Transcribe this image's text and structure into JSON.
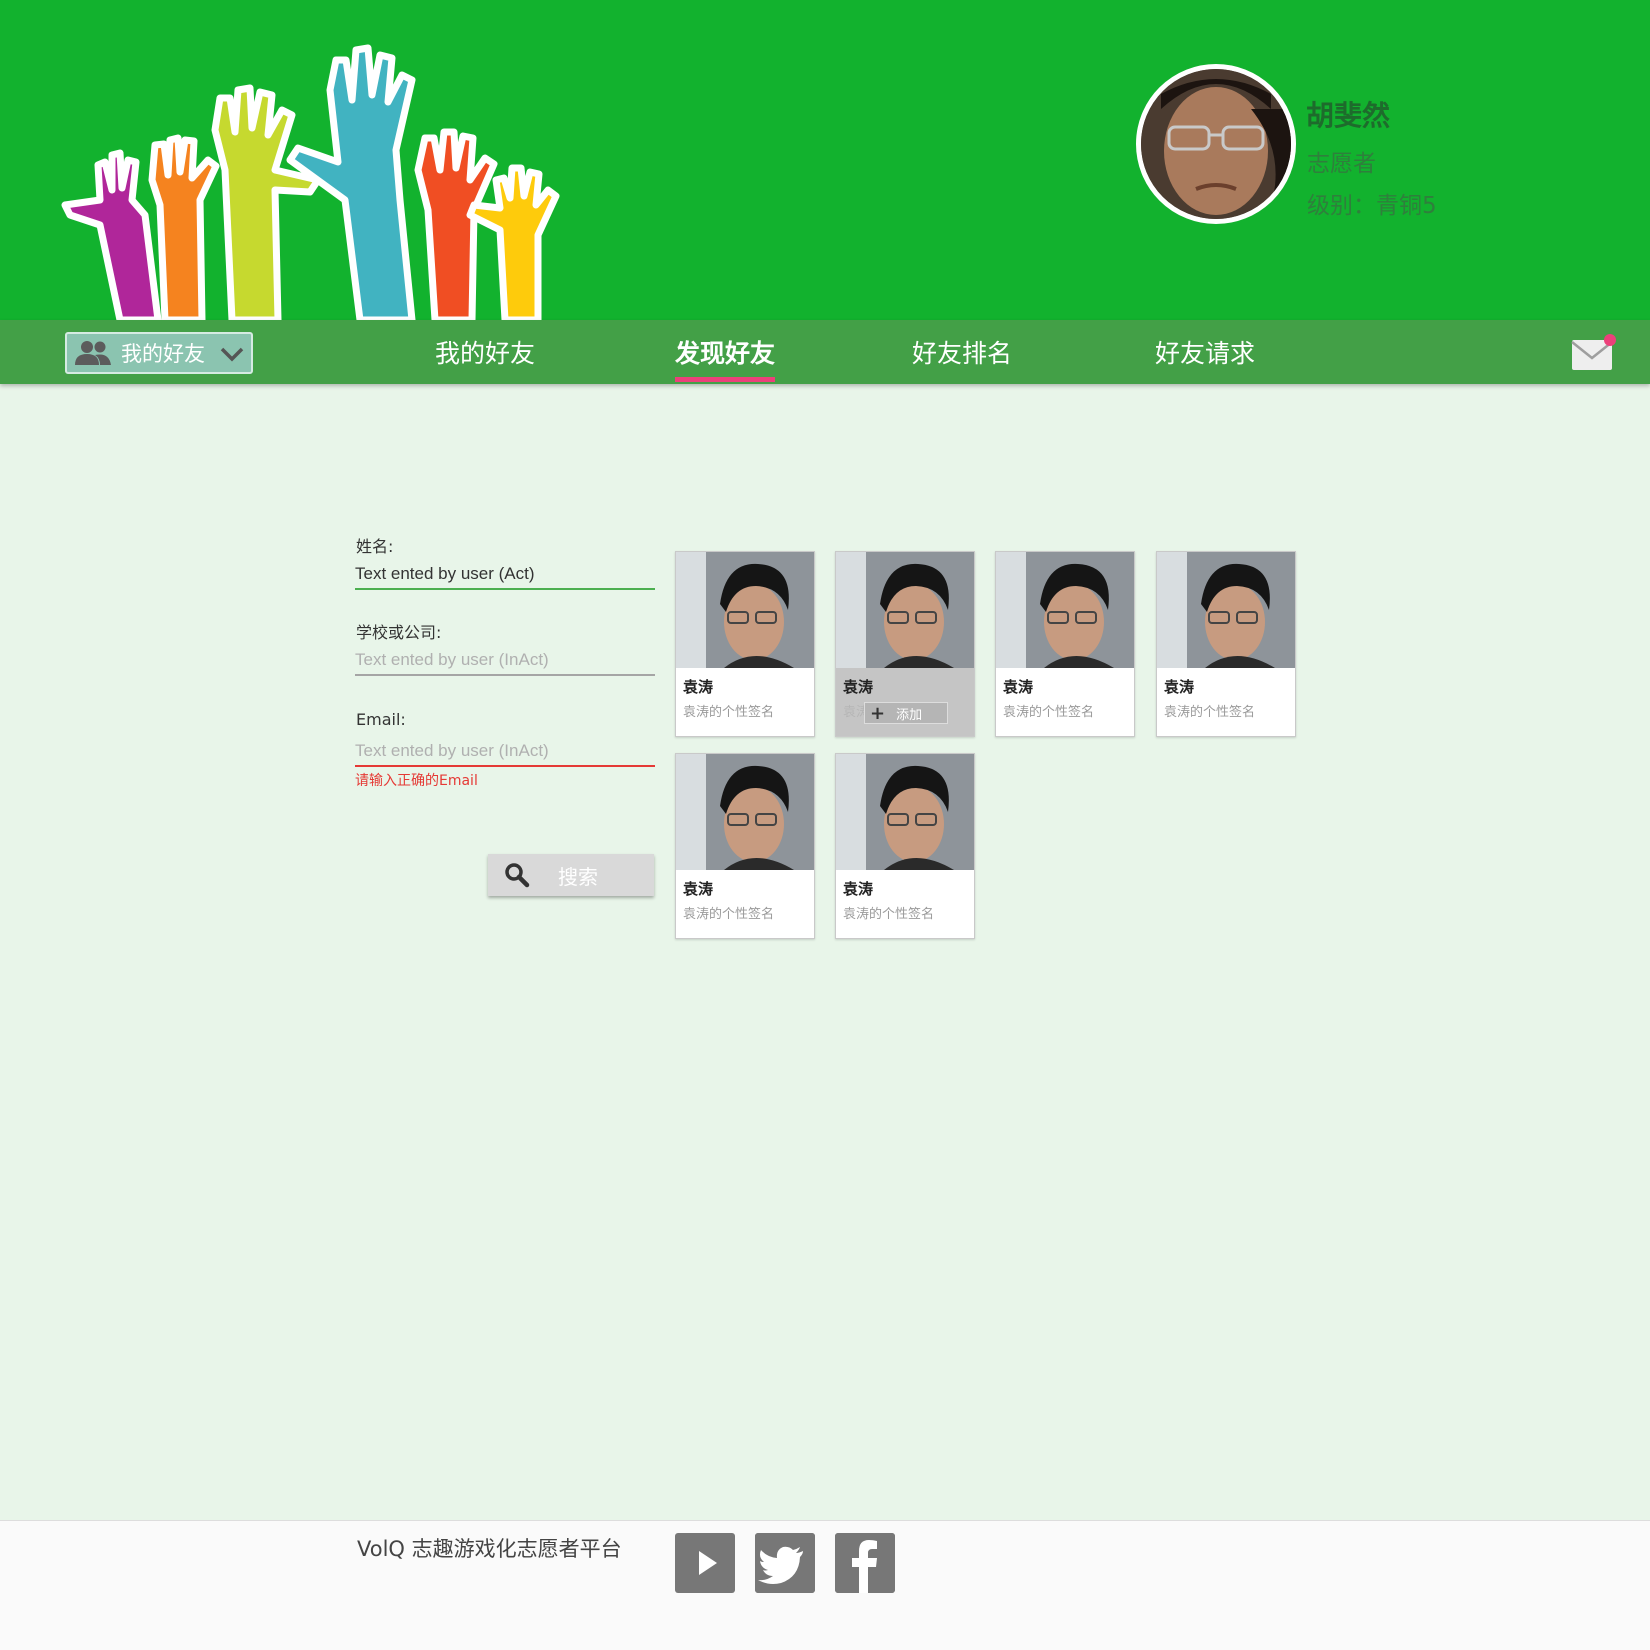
{
  "header": {
    "user_name": "胡斐然",
    "user_role": "志愿者",
    "user_level": "级别：青铜5"
  },
  "nav": {
    "dropdown_label": "我的好友",
    "tabs": [
      {
        "label": "我的好友",
        "active": false
      },
      {
        "label": "发现好友",
        "active": true
      },
      {
        "label": "好友排名",
        "active": false
      },
      {
        "label": "好友请求",
        "active": false
      }
    ],
    "has_unread_mail": true
  },
  "search_form": {
    "name_label": "姓名:",
    "name_value": "Text ented by user (Act)",
    "org_label": "学校或公司:",
    "org_placeholder": "Text ented by user (InAct)",
    "email_label": "Email:",
    "email_placeholder": "Text ented by user (InAct)",
    "email_error": "请输入正确的Email",
    "search_label": "搜索"
  },
  "friends": [
    {
      "name": "袁涛",
      "signature": "袁涛的个性签名"
    },
    {
      "name": "袁涛",
      "signature": "袁涛的个性签名",
      "hovered": true,
      "add_label": "添加"
    },
    {
      "name": "袁涛",
      "signature": "袁涛的个性签名"
    },
    {
      "name": "袁涛",
      "signature": "袁涛的个性签名"
    },
    {
      "name": "袁涛",
      "signature": "袁涛的个性签名"
    },
    {
      "name": "袁涛",
      "signature": "袁涛的个性签名"
    }
  ],
  "footer": {
    "text": "VolQ 志趣游戏化志愿者平台",
    "social_icons": [
      "youtube-icon",
      "twitter-icon",
      "facebook-icon"
    ]
  },
  "colors": {
    "header_green": "#12b22e",
    "nav_green": "#43a047",
    "page_bg": "#e8f5e9",
    "active_tab_underline": "#ec407a",
    "error_red": "#e53935"
  }
}
